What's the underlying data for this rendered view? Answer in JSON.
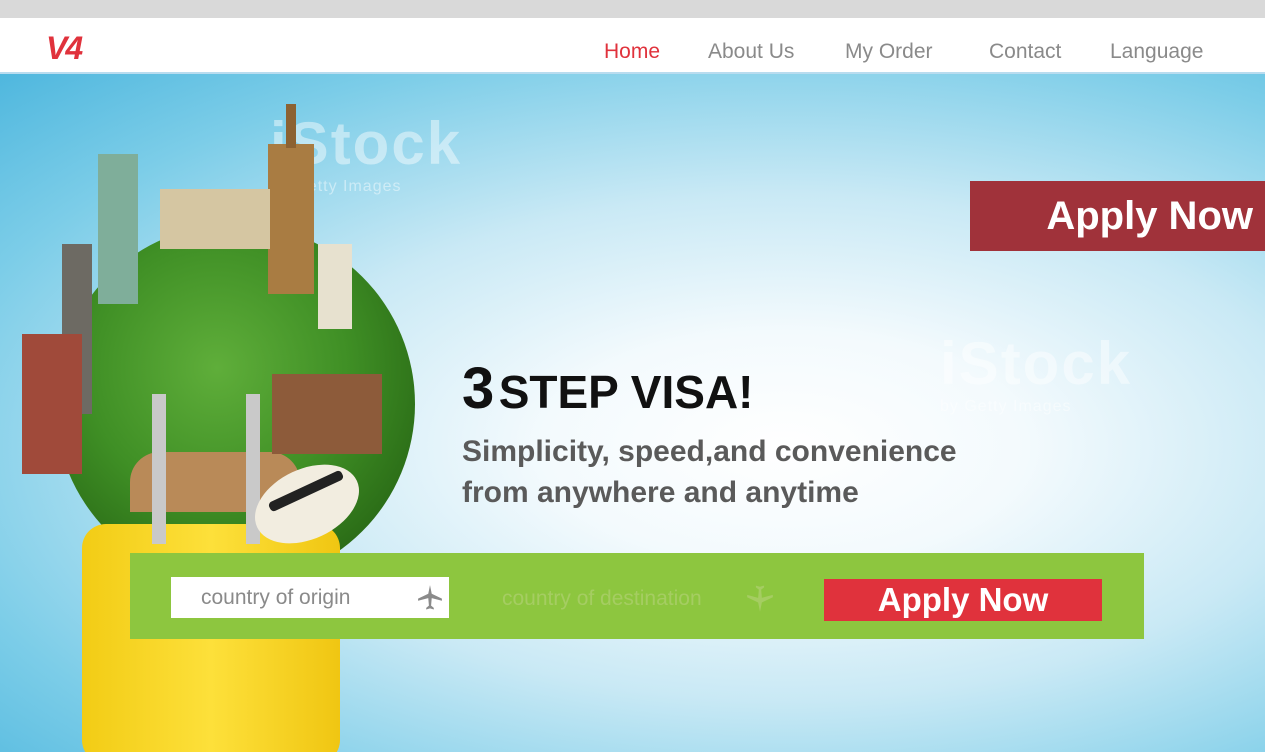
{
  "brand": {
    "logo": "V4",
    "accent": "#e0323c"
  },
  "nav": {
    "items": [
      {
        "label": "Home",
        "active": true
      },
      {
        "label": "About Us",
        "active": false
      },
      {
        "label": "My Order",
        "active": false
      },
      {
        "label": "Contact",
        "active": false
      },
      {
        "label": "Language",
        "active": false
      }
    ]
  },
  "hero": {
    "apply_top_label": "Apply Now",
    "headline_number": "3",
    "headline_text": "STEP VISA!",
    "tagline_line1": "Simplicity, speed,and convenience",
    "tagline_line2": "from anywhere and anytime",
    "watermark_brand": "iStock",
    "watermark_sub": "by Getty Images"
  },
  "search": {
    "origin_placeholder": "country of origin",
    "origin_icon": "airplane-takeoff-icon",
    "destination_label": "country of  destination",
    "destination_icon": "airplane-landing-icon",
    "apply_label": "Apply Now",
    "bar_color": "#8dc63f"
  }
}
